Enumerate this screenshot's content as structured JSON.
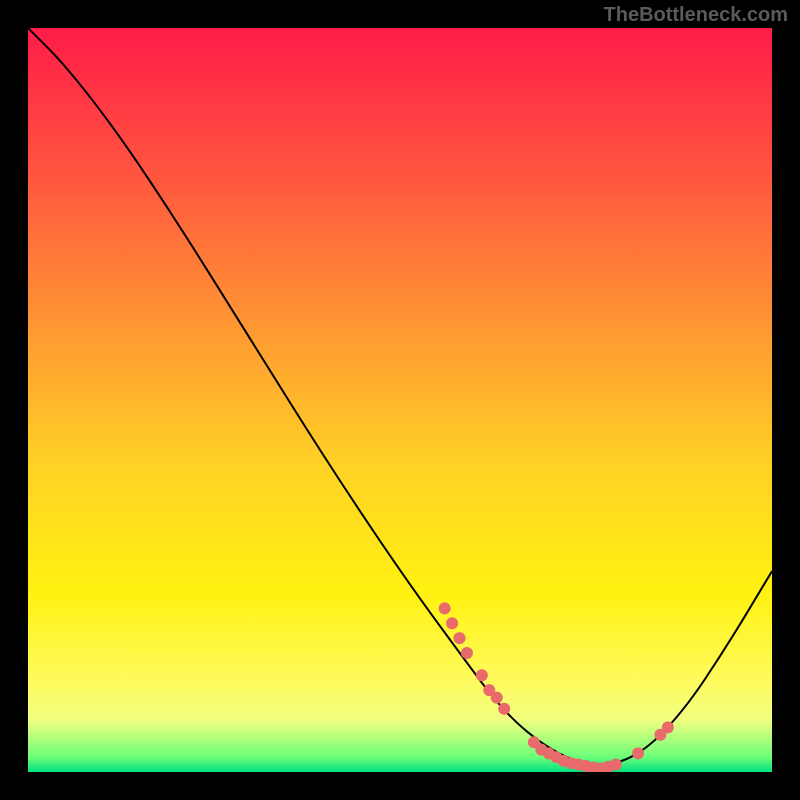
{
  "watermark": "TheBottleneck.com",
  "chart_data": {
    "type": "line",
    "title": "",
    "xlabel": "",
    "ylabel": "",
    "xlim": [
      0,
      100
    ],
    "ylim": [
      0,
      100
    ],
    "curve": [
      {
        "x": 0,
        "y": 100
      },
      {
        "x": 5,
        "y": 95
      },
      {
        "x": 12,
        "y": 86
      },
      {
        "x": 20,
        "y": 74
      },
      {
        "x": 30,
        "y": 58
      },
      {
        "x": 40,
        "y": 42
      },
      {
        "x": 50,
        "y": 27
      },
      {
        "x": 58,
        "y": 16
      },
      {
        "x": 64,
        "y": 8
      },
      {
        "x": 70,
        "y": 3
      },
      {
        "x": 76,
        "y": 0.5
      },
      {
        "x": 82,
        "y": 2
      },
      {
        "x": 88,
        "y": 8
      },
      {
        "x": 94,
        "y": 17
      },
      {
        "x": 100,
        "y": 27
      }
    ],
    "points": [
      {
        "x": 56,
        "y": 22
      },
      {
        "x": 57,
        "y": 20
      },
      {
        "x": 58,
        "y": 18
      },
      {
        "x": 59,
        "y": 16
      },
      {
        "x": 61,
        "y": 13
      },
      {
        "x": 62,
        "y": 11
      },
      {
        "x": 63,
        "y": 10
      },
      {
        "x": 64,
        "y": 8.5
      },
      {
        "x": 68,
        "y": 4
      },
      {
        "x": 69,
        "y": 3
      },
      {
        "x": 70,
        "y": 2.5
      },
      {
        "x": 71,
        "y": 2
      },
      {
        "x": 72,
        "y": 1.5
      },
      {
        "x": 73,
        "y": 1.2
      },
      {
        "x": 74,
        "y": 1
      },
      {
        "x": 75,
        "y": 0.8
      },
      {
        "x": 76,
        "y": 0.6
      },
      {
        "x": 77,
        "y": 0.5
      },
      {
        "x": 78,
        "y": 0.7
      },
      {
        "x": 79,
        "y": 1.0
      },
      {
        "x": 82,
        "y": 2.5
      },
      {
        "x": 85,
        "y": 5
      },
      {
        "x": 86,
        "y": 6
      }
    ],
    "gradient_stops": [
      {
        "pos": 0,
        "color": "#ff1c48"
      },
      {
        "pos": 18,
        "color": "#ff5040"
      },
      {
        "pos": 38,
        "color": "#ff9034"
      },
      {
        "pos": 58,
        "color": "#ffd026"
      },
      {
        "pos": 76,
        "color": "#fff210"
      },
      {
        "pos": 88,
        "color": "#fffb60"
      },
      {
        "pos": 93,
        "color": "#f0ff80"
      },
      {
        "pos": 98,
        "color": "#6cff78"
      },
      {
        "pos": 100,
        "color": "#00e080"
      }
    ]
  }
}
